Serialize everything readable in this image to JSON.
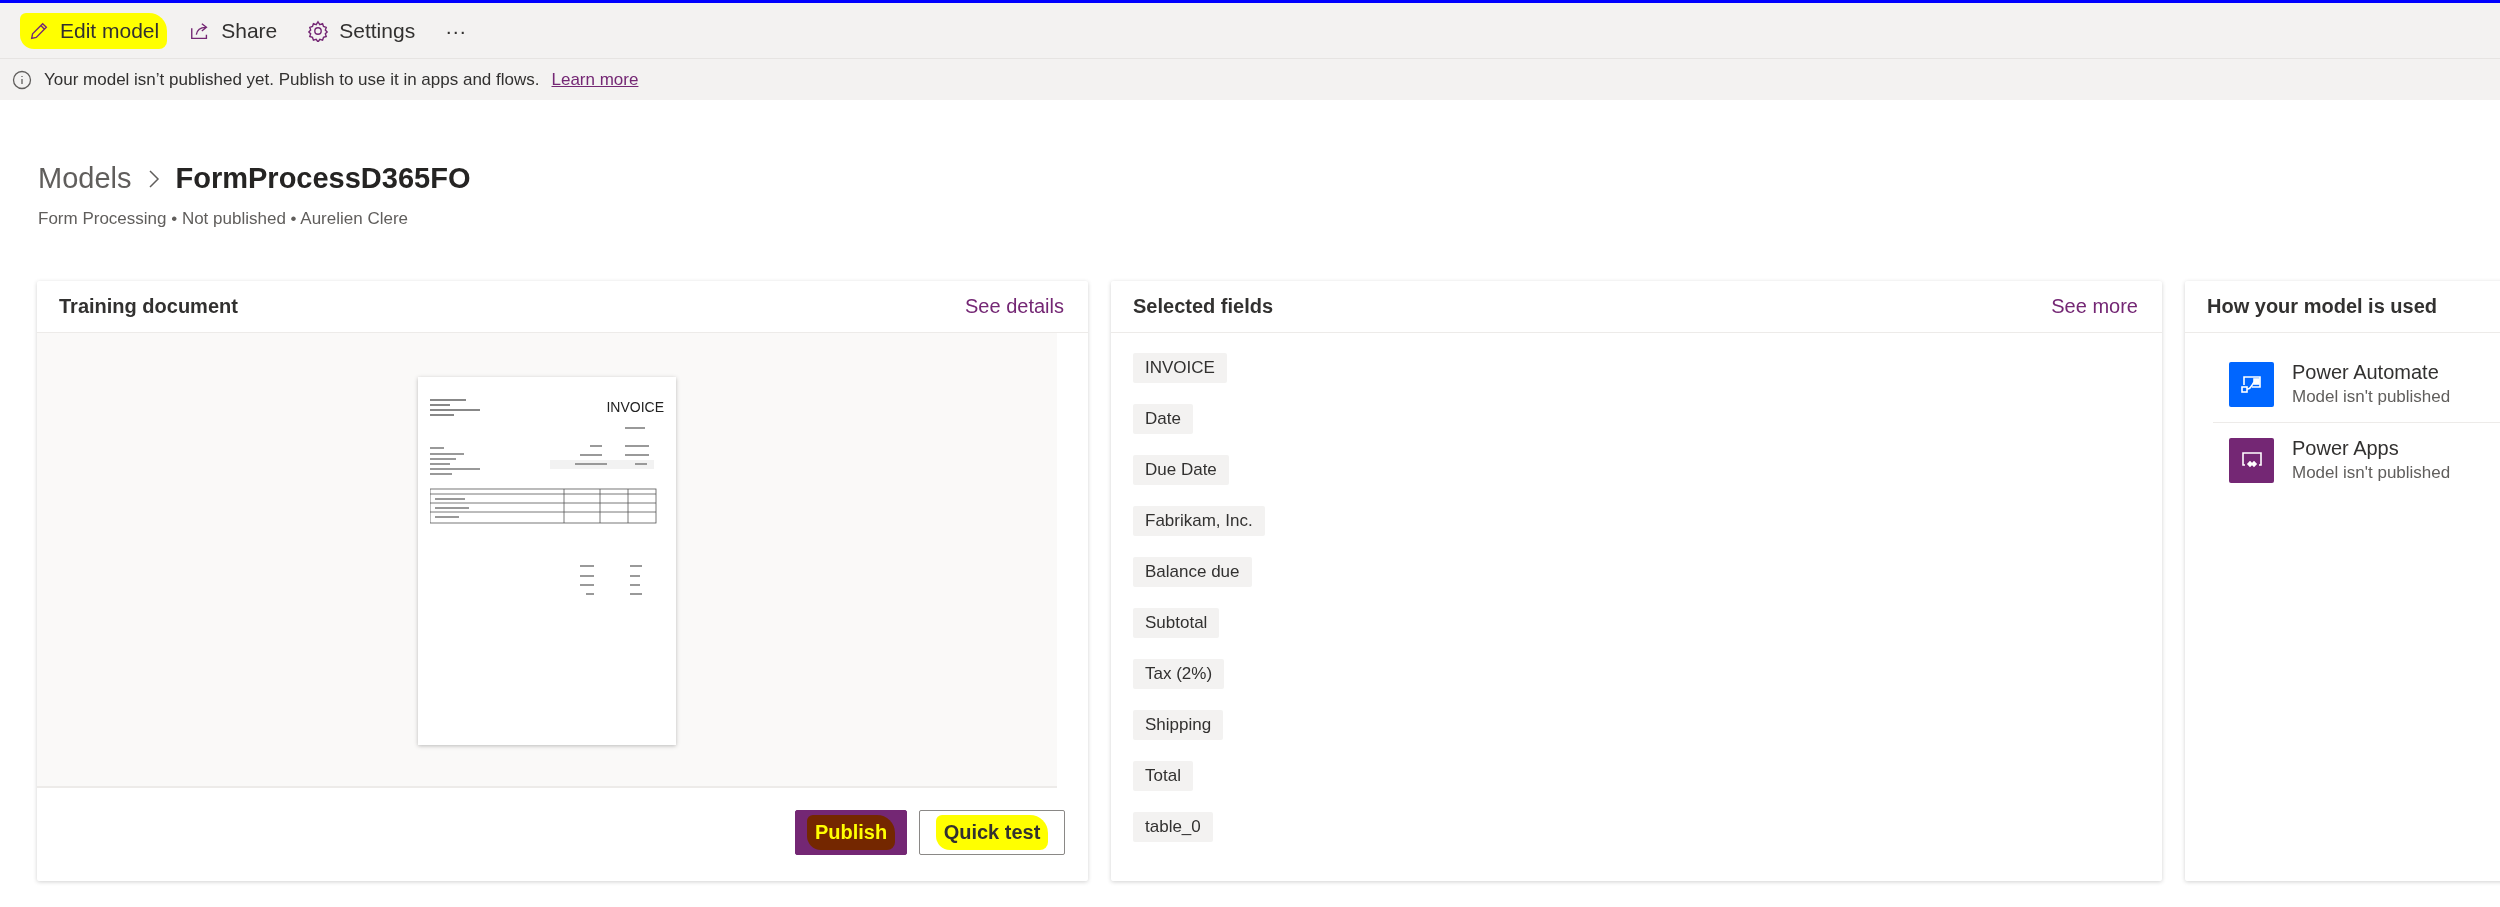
{
  "toolbar": {
    "items": [
      {
        "kind": "edit",
        "label": "Edit model",
        "highlighted": true
      },
      {
        "kind": "share",
        "label": "Share",
        "highlighted": false
      },
      {
        "kind": "settings",
        "label": "Settings",
        "highlighted": false
      },
      {
        "kind": "more",
        "label": "···",
        "highlighted": false
      }
    ]
  },
  "notice": {
    "text": "Your model isn’t published yet. Publish to use it in apps and flows.",
    "link": "Learn more"
  },
  "breadcrumb": {
    "parent": "Models",
    "current": "FormProcessD365FO"
  },
  "subtitle": "Form Processing • Not published • Aurelien Clere",
  "training_document": {
    "title": "Training document",
    "link": "See details",
    "thumbnail_title": "INVOICE",
    "buttons": [
      {
        "kind": "primary",
        "label": "Publish",
        "highlighted": true
      },
      {
        "kind": "secondary",
        "label": "Quick test",
        "highlighted": true
      }
    ]
  },
  "selected_fields": {
    "title": "Selected fields",
    "link": "See more",
    "fields": [
      "INVOICE",
      "Date",
      "Due Date",
      "Fabrikam, Inc.",
      "Balance due",
      "Subtotal",
      "Tax (2%)",
      "Shipping",
      "Total",
      "table_0"
    ]
  },
  "usage": {
    "title": "How your model is used",
    "items": [
      {
        "kind": "automate",
        "name": "Power Automate",
        "status": "Model isn't published"
      },
      {
        "kind": "apps",
        "name": "Power Apps",
        "status": "Model isn't published"
      }
    ]
  }
}
